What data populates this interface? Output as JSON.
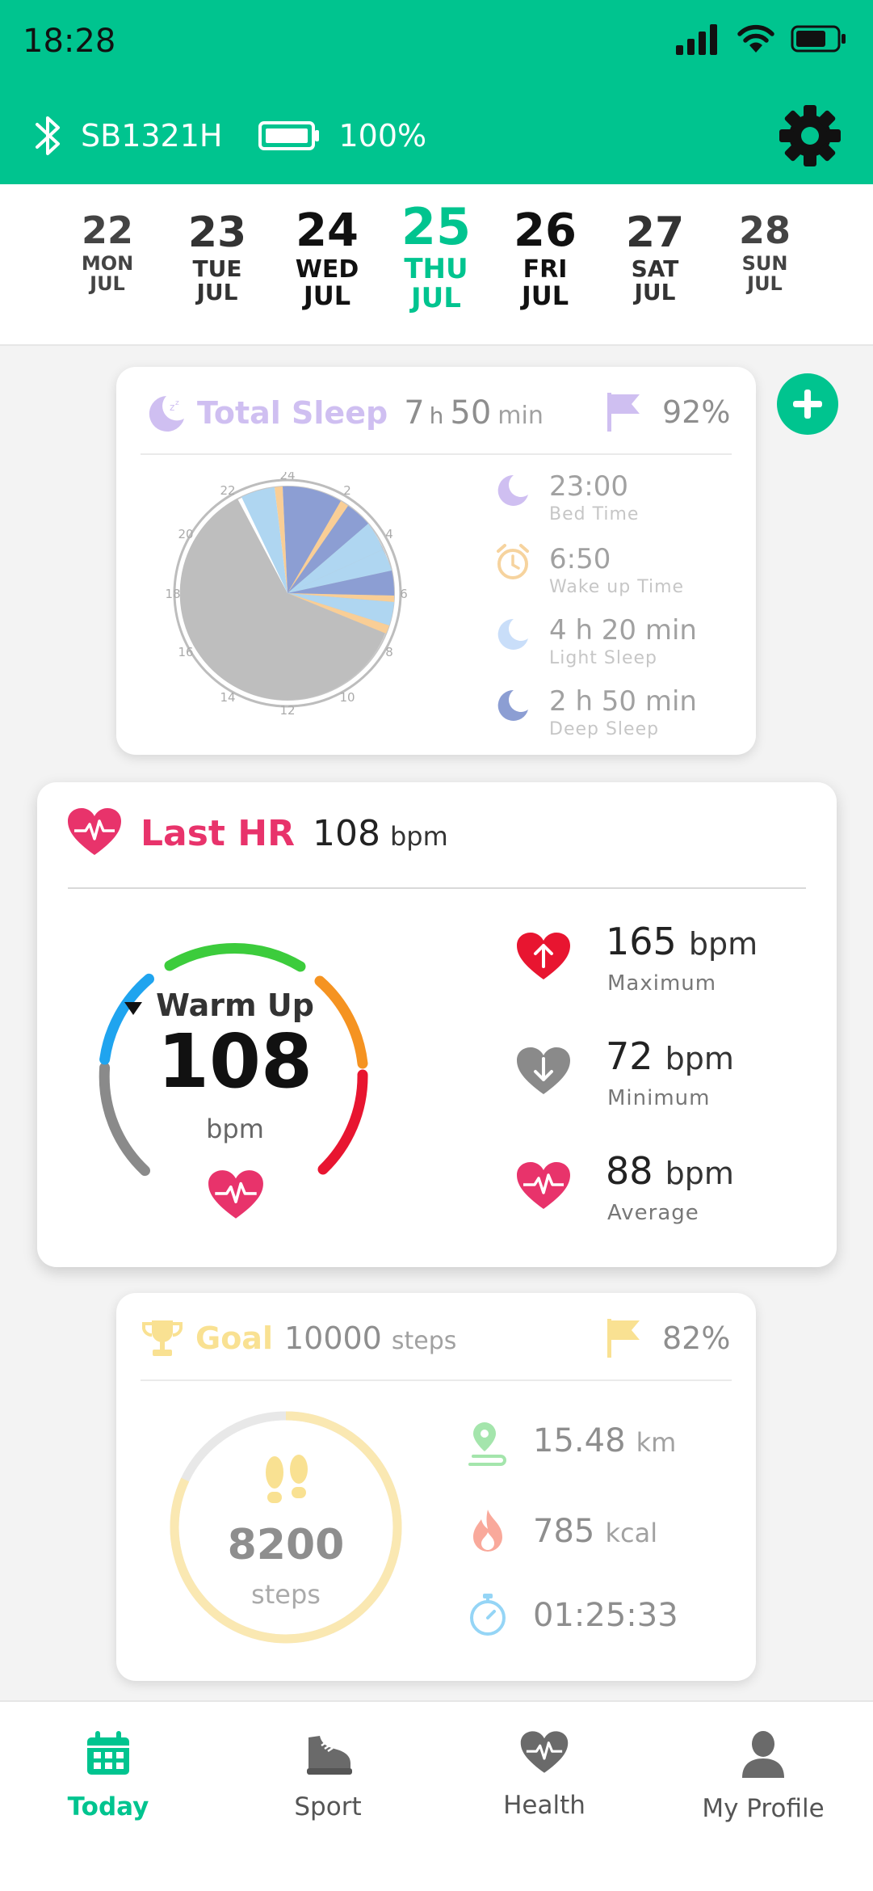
{
  "status_bar": {
    "time": "18:28"
  },
  "header": {
    "device_name": "SB1321H",
    "battery": "100%"
  },
  "dates": [
    {
      "num": "22",
      "dow": "MON",
      "mon": "JUL",
      "selected": false
    },
    {
      "num": "23",
      "dow": "TUE",
      "mon": "JUL",
      "selected": false
    },
    {
      "num": "24",
      "dow": "WED",
      "mon": "JUL",
      "selected": false
    },
    {
      "num": "25",
      "dow": "THU",
      "mon": "JUL",
      "selected": true
    },
    {
      "num": "26",
      "dow": "FRI",
      "mon": "JUL",
      "selected": false
    },
    {
      "num": "27",
      "dow": "SAT",
      "mon": "JUL",
      "selected": false
    },
    {
      "num": "28",
      "dow": "SUN",
      "mon": "JUL",
      "selected": false
    }
  ],
  "sleep": {
    "title": "Total Sleep",
    "hours": "7",
    "h_unit": "h",
    "minutes": "50",
    "min_unit": "min",
    "percent": "92%",
    "clock_labels": [
      "24",
      "2",
      "4",
      "6",
      "8",
      "10",
      "12",
      "14",
      "16",
      "18",
      "20",
      "22"
    ],
    "stats": [
      {
        "value": "23:00",
        "label": "Bed Time",
        "icon": "moon-icon"
      },
      {
        "value": "6:50",
        "label": "Wake up Time",
        "icon": "alarm-clock-icon"
      },
      {
        "value": "4 h 20 min",
        "label": "Light Sleep",
        "icon": "light-moon-icon"
      },
      {
        "value": "2 h 50 min",
        "label": "Deep Sleep",
        "icon": "deep-moon-icon"
      }
    ]
  },
  "hr": {
    "title": "Last HR",
    "value": "108",
    "unit": "bpm",
    "zone": "Warm Up",
    "gauge_value": "108",
    "gauge_unit": "bpm",
    "stats": [
      {
        "value": "165",
        "unit": "bpm",
        "label": "Maximum",
        "icon": "heart-up-icon"
      },
      {
        "value": "72",
        "unit": "bpm",
        "label": "Minimum",
        "icon": "heart-down-icon"
      },
      {
        "value": "88",
        "unit": "bpm",
        "label": "Average",
        "icon": "heart-pulse-icon"
      }
    ]
  },
  "goal": {
    "title": "Goal",
    "target": "10000",
    "target_unit": "steps",
    "percent": "82%",
    "steps": "8200",
    "steps_unit": "steps",
    "progress": 0.82,
    "stats": [
      {
        "value": "15.48",
        "unit": "km",
        "icon": "route-pin-icon"
      },
      {
        "value": "785",
        "unit": "kcal",
        "icon": "flame-icon"
      },
      {
        "value": "01:25:33",
        "unit": "",
        "icon": "stopwatch-icon"
      }
    ]
  },
  "nav": [
    {
      "label": "Today",
      "icon": "calendar-icon",
      "active": true
    },
    {
      "label": "Sport",
      "icon": "shoe-icon",
      "active": false
    },
    {
      "label": "Health",
      "icon": "heart-pulse-icon",
      "active": false
    },
    {
      "label": "My Profile",
      "icon": "person-icon",
      "active": false
    }
  ],
  "colors": {
    "brand": "#00c48f",
    "hr_accent": "#e8336b",
    "sleep_accent": "#c7b0ef",
    "goal_accent": "#f7d774"
  }
}
